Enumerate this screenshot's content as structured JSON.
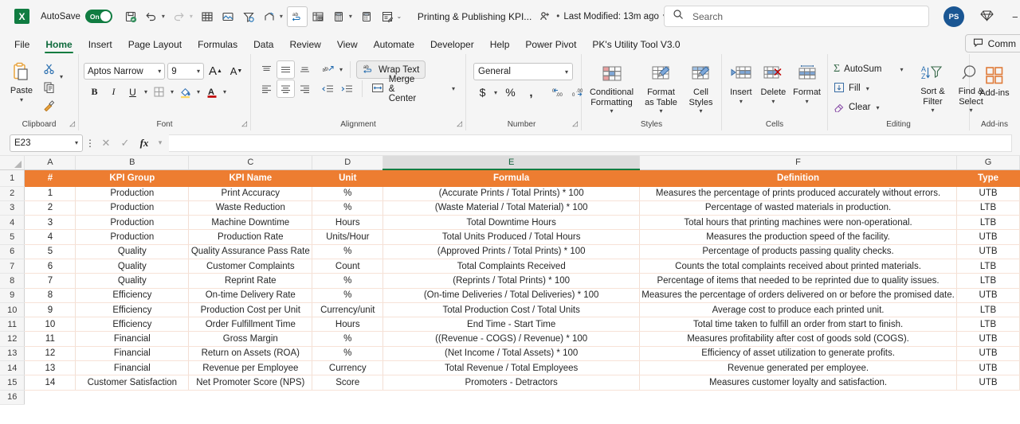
{
  "titlebar": {
    "app_logo_letter": "X",
    "autosave_label": "AutoSave",
    "autosave_state": "On",
    "doc_title": "Printing & Publishing KPI...",
    "last_modified": "Last Modified: 13m ago",
    "search_placeholder": "Search",
    "search_value": "",
    "avatar_initials": "PS",
    "quick_access": [
      "save-icon",
      "undo-icon",
      "redo-icon",
      "table-icon",
      "picture-icon",
      "filter-icon",
      "share-icon",
      "spelling-icon",
      "pivot-icon",
      "calculator-icon",
      "calculator2-icon",
      "form-icon",
      "more-icon"
    ]
  },
  "tabs": [
    {
      "label": "File",
      "active": false
    },
    {
      "label": "Home",
      "active": true
    },
    {
      "label": "Insert",
      "active": false
    },
    {
      "label": "Page Layout",
      "active": false
    },
    {
      "label": "Formulas",
      "active": false
    },
    {
      "label": "Data",
      "active": false
    },
    {
      "label": "Review",
      "active": false
    },
    {
      "label": "View",
      "active": false
    },
    {
      "label": "Automate",
      "active": false
    },
    {
      "label": "Developer",
      "active": false
    },
    {
      "label": "Help",
      "active": false
    },
    {
      "label": "Power Pivot",
      "active": false
    },
    {
      "label": "PK's Utility Tool V3.0",
      "active": false
    }
  ],
  "comment_button": "Comm",
  "ribbon": {
    "clipboard": {
      "label": "Clipboard",
      "paste": "Paste",
      "cut": "cut-icon",
      "copy": "copy-icon",
      "format_painter": "format-painter-icon"
    },
    "font": {
      "label": "Font",
      "font_name": "Aptos Narrow",
      "font_size": "9",
      "grow": "A",
      "shrink": "A",
      "bold": "B",
      "italic": "I",
      "underline": "U",
      "borders": "borders-icon",
      "fill_color": "fill-color-icon",
      "font_color": "font-color-icon"
    },
    "alignment": {
      "label": "Alignment",
      "wrap_text": "Wrap Text",
      "merge_center": "Merge & Center",
      "orientation": "orientation-icon"
    },
    "number": {
      "label": "Number",
      "format": "General",
      "currency": "$",
      "percent": "%",
      "comma": ",",
      "increase_decimal": ".00",
      "decrease_decimal": ".00"
    },
    "styles": {
      "label": "Styles",
      "conditional_formatting": "Conditional Formatting",
      "format_as_table": "Format as Table",
      "cell_styles": "Cell Styles"
    },
    "cells": {
      "label": "Cells",
      "insert": "Insert",
      "delete": "Delete",
      "format": "Format"
    },
    "editing": {
      "label": "Editing",
      "autosum": "AutoSum",
      "fill": "Fill",
      "clear": "Clear",
      "sort_filter": "Sort & Filter",
      "find_select": "Find & Select"
    },
    "addins": {
      "label": "Add-ins",
      "addins": "Add-ins"
    }
  },
  "formula_bar": {
    "name_box": "E23",
    "formula_value": "",
    "cancel_icon": "cancel-icon",
    "enter_icon": "enter-icon",
    "fx_icon": "fx"
  },
  "grid": {
    "columns": [
      "A",
      "B",
      "C",
      "D",
      "E",
      "F",
      "G"
    ],
    "selected_column": "E",
    "rows": [
      "1",
      "2",
      "3",
      "4",
      "5",
      "6",
      "7",
      "8",
      "9",
      "10",
      "11",
      "12",
      "13",
      "14",
      "15",
      "16"
    ],
    "header_row": [
      "#",
      "KPI Group",
      "KPI Name",
      "Unit",
      "Formula",
      "Definition",
      "Type"
    ],
    "data": [
      [
        "1",
        "Production",
        "Print Accuracy",
        "%",
        "(Accurate Prints / Total Prints) * 100",
        "Measures the percentage of prints produced accurately without errors.",
        "UTB"
      ],
      [
        "2",
        "Production",
        "Waste Reduction",
        "%",
        "(Waste Material / Total Material) * 100",
        "Percentage of wasted materials in production.",
        "LTB"
      ],
      [
        "3",
        "Production",
        "Machine Downtime",
        "Hours",
        "Total Downtime Hours",
        "Total hours that printing machines were non-operational.",
        "LTB"
      ],
      [
        "4",
        "Production",
        "Production Rate",
        "Units/Hour",
        "Total Units Produced / Total Hours",
        "Measures the production speed of the facility.",
        "UTB"
      ],
      [
        "5",
        "Quality",
        "Quality Assurance Pass Rate",
        "%",
        "(Approved Prints / Total Prints) * 100",
        "Percentage of products passing quality checks.",
        "UTB"
      ],
      [
        "6",
        "Quality",
        "Customer Complaints",
        "Count",
        "Total Complaints Received",
        "Counts the total complaints received about printed materials.",
        "LTB"
      ],
      [
        "7",
        "Quality",
        "Reprint Rate",
        "%",
        "(Reprints / Total Prints) * 100",
        "Percentage of items that needed to be reprinted due to quality issues.",
        "LTB"
      ],
      [
        "8",
        "Efficiency",
        "On-time Delivery Rate",
        "%",
        "(On-time Deliveries / Total Deliveries) * 100",
        "Measures the percentage of orders delivered on or before the promised date.",
        "UTB"
      ],
      [
        "9",
        "Efficiency",
        "Production Cost per Unit",
        "Currency/unit",
        "Total Production Cost / Total Units",
        "Average cost to produce each printed unit.",
        "LTB"
      ],
      [
        "10",
        "Efficiency",
        "Order Fulfillment Time",
        "Hours",
        "End Time - Start Time",
        "Total time taken to fulfill an order from start to finish.",
        "LTB"
      ],
      [
        "11",
        "Financial",
        "Gross Margin",
        "%",
        "((Revenue - COGS) / Revenue) * 100",
        "Measures profitability after cost of goods sold (COGS).",
        "UTB"
      ],
      [
        "12",
        "Financial",
        "Return on Assets (ROA)",
        "%",
        "(Net Income / Total Assets) * 100",
        "Efficiency of asset utilization to generate profits.",
        "UTB"
      ],
      [
        "13",
        "Financial",
        "Revenue per Employee",
        "Currency",
        "Total Revenue / Total Employees",
        "Revenue generated per employee.",
        "UTB"
      ],
      [
        "14",
        "Customer Satisfaction",
        "Net Promoter Score (NPS)",
        "Score",
        "Promoters - Detractors",
        "Measures customer loyalty and satisfaction.",
        "UTB"
      ]
    ]
  },
  "colors": {
    "table_header_bg": "#ED7D31",
    "accent_green": "#107c41",
    "avatar_bg": "#1a5693",
    "grid_border": "#f2dfd4"
  }
}
